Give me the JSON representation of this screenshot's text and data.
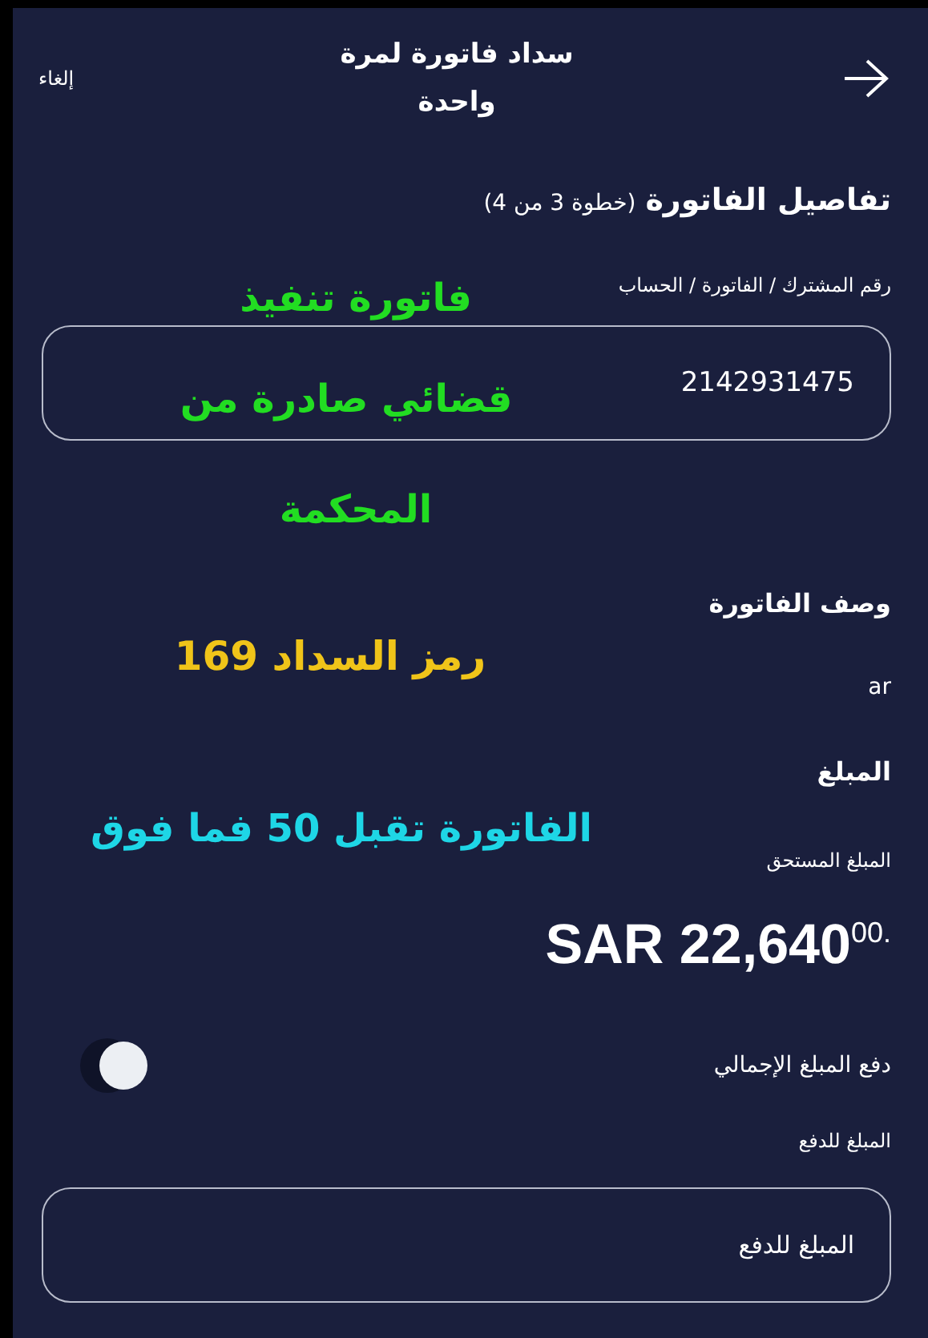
{
  "header": {
    "title": "سداد فاتورة لمرة واحدة",
    "cancel": "إلغاء"
  },
  "section": {
    "title": "تفاصيل الفاتورة",
    "step": "(خطوة 3 من 4)"
  },
  "account": {
    "label": "رقم المشترك / الفاتورة / الحساب",
    "value": "2142931475"
  },
  "description": {
    "title": "وصف الفاتورة",
    "value": "ar"
  },
  "amount": {
    "title": "المبلغ",
    "due_label": "المبلغ المستحق",
    "due_value": "SAR 22,640$^{00.}$"
  },
  "pay_total": {
    "label": "دفع المبلغ الإجمالي",
    "on": false
  },
  "pay_amount": {
    "label": "المبلغ للدفع",
    "placeholder": "المبلغ للدفع"
  },
  "annotations": [
    {
      "text": "فاتورة تنفيذ",
      "color": "#22dd22"
    },
    {
      "text": "قضائي صادرة من",
      "color": "#22dd22"
    },
    {
      "text": "المحكمة",
      "color": "#22dd22"
    },
    {
      "text": "رمز السداد 169",
      "color": "#f0c419"
    },
    {
      "text": "الفاتورة تقبل 50 فما فوق",
      "color": "#1ed6e6"
    }
  ]
}
